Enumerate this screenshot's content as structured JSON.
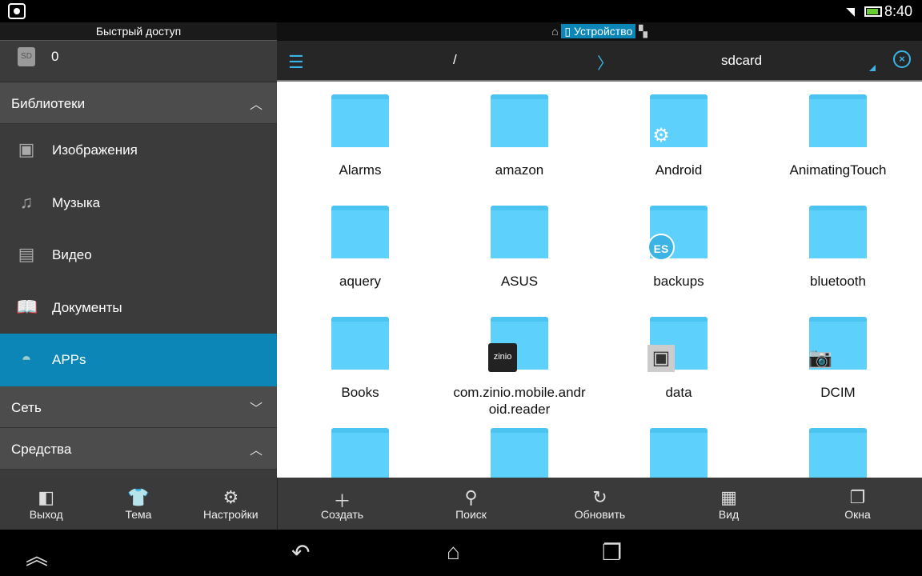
{
  "status": {
    "time": "8:40"
  },
  "sidebar": {
    "quick_access": "Быстрый доступ",
    "sd_label": "0",
    "sd_icon_text": "SD",
    "sections": [
      {
        "label": "Библиотеки",
        "state": "expanded"
      },
      {
        "label": "Сеть",
        "state": "collapsed"
      },
      {
        "label": "Средства",
        "state": "expanded"
      }
    ],
    "items": [
      {
        "label": "Изображения",
        "icon": "image-icon"
      },
      {
        "label": "Музыка",
        "icon": "music-icon"
      },
      {
        "label": "Видео",
        "icon": "video-icon"
      },
      {
        "label": "Документы",
        "icon": "book-icon"
      },
      {
        "label": "APPs",
        "icon": "android-icon",
        "selected": true
      }
    ],
    "toolbar": [
      "Выход",
      "Тема",
      "Настройки"
    ]
  },
  "location": {
    "device": "Устройство"
  },
  "path": {
    "root": "/",
    "current": "sdcard"
  },
  "folders": [
    {
      "name": "Alarms"
    },
    {
      "name": "amazon"
    },
    {
      "name": "Android",
      "badge": "gear"
    },
    {
      "name": "AnimatingTouch"
    },
    {
      "name": "aquery"
    },
    {
      "name": "ASUS"
    },
    {
      "name": "backups",
      "badge": "es"
    },
    {
      "name": "bluetooth"
    },
    {
      "name": "Books"
    },
    {
      "name": "com.zinio.mobile.android.reader",
      "badge": "zinio"
    },
    {
      "name": "data",
      "badge": "app"
    },
    {
      "name": "DCIM",
      "badge": "camera"
    },
    {
      "name": ""
    },
    {
      "name": ""
    },
    {
      "name": ""
    },
    {
      "name": ""
    }
  ],
  "zinio_text": "zinio",
  "toolbar": [
    "Создать",
    "Поиск",
    "Обновить",
    "Вид",
    "Окна"
  ]
}
